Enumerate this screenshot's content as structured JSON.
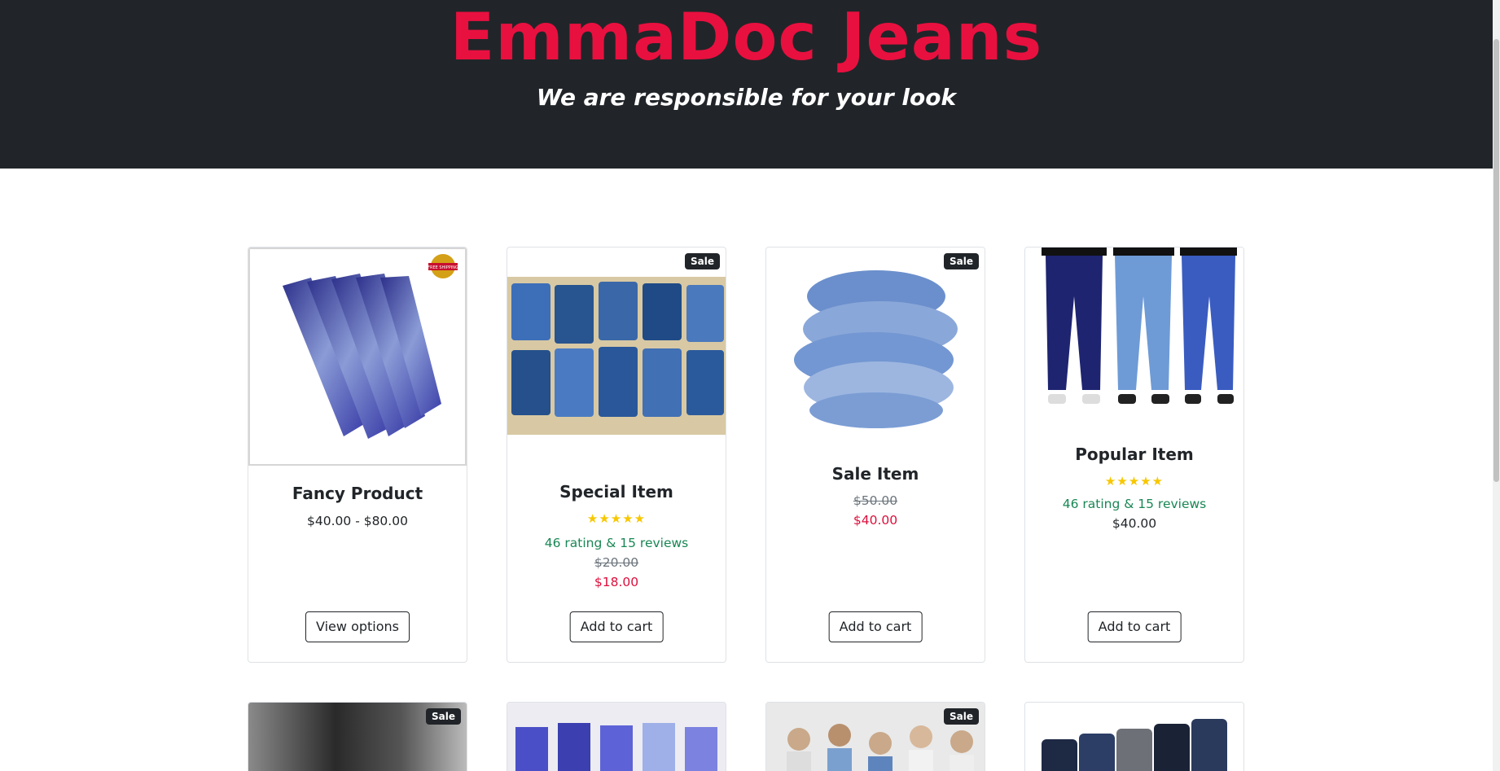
{
  "header": {
    "brand": "EmmaDoc Jeans",
    "tagline": "We are responsible for your look",
    "brand_color": "#e8103f",
    "background": "#212529"
  },
  "products": [
    {
      "title": "Fancy Product",
      "badge": "",
      "price": "$40.00 - $80.00",
      "button": "View options",
      "image_icon": "jeans-fan-photo",
      "seal_text": "FREE SHIPPING"
    },
    {
      "title": "Special Item",
      "badge": "Sale",
      "stars": "★★★★★",
      "rating_text": "46 rating & 15 reviews",
      "old_price": "$20.00",
      "new_price": "$18.00",
      "button": "Add to cart",
      "image_icon": "folded-jeans-photo"
    },
    {
      "title": "Sale Item",
      "badge": "Sale",
      "old_price": "$50.00",
      "new_price": "$40.00",
      "button": "Add to cart",
      "image_icon": "jeans-stack-photo"
    },
    {
      "title": "Popular Item",
      "badge": "",
      "stars": "★★★★★",
      "rating_text": "46 rating & 15 reviews",
      "price": "$40.00",
      "button": "Add to cart",
      "image_icon": "models-legs-photo"
    }
  ],
  "row2": [
    {
      "badge": "Sale",
      "image_icon": "black-jeans-photo"
    },
    {
      "badge": "",
      "image_icon": "women-jeans-photo"
    },
    {
      "badge": "Sale",
      "image_icon": "group-models-photo"
    },
    {
      "badge": "",
      "image_icon": "dark-jeans-row-photo"
    }
  ],
  "colors": {
    "rating_green": "#198754",
    "sale_red": "#dc0f3c",
    "star_yellow": "#f7c700"
  }
}
